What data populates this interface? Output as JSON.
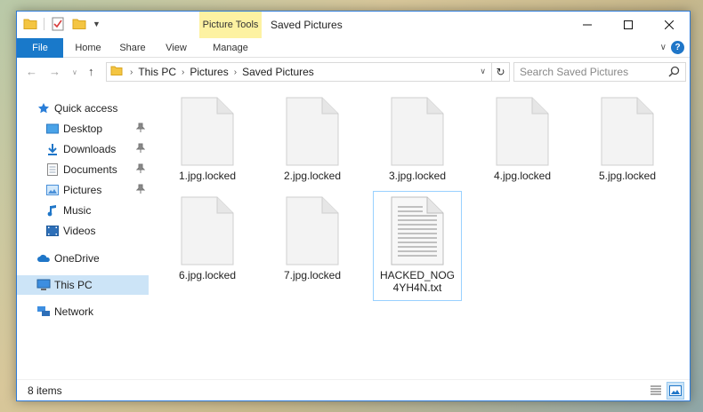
{
  "window": {
    "title": "Saved Pictures",
    "context_tab_group": "Picture Tools"
  },
  "ribbon": {
    "tabs": [
      {
        "label": "File"
      },
      {
        "label": "Home"
      },
      {
        "label": "Share"
      },
      {
        "label": "View"
      },
      {
        "label": "Manage"
      }
    ]
  },
  "address": {
    "breadcrumbs": [
      "This PC",
      "Pictures",
      "Saved Pictures"
    ]
  },
  "search": {
    "placeholder": "Search Saved Pictures"
  },
  "sidebar": {
    "items": [
      {
        "label": "Quick access",
        "icon": "star-icon"
      },
      {
        "label": "Desktop",
        "icon": "desktop-folder-icon",
        "pinned": true
      },
      {
        "label": "Downloads",
        "icon": "downloads-folder-icon",
        "pinned": true
      },
      {
        "label": "Documents",
        "icon": "documents-folder-icon",
        "pinned": true
      },
      {
        "label": "Pictures",
        "icon": "pictures-folder-icon",
        "pinned": true
      },
      {
        "label": "Music",
        "icon": "music-folder-icon"
      },
      {
        "label": "Videos",
        "icon": "videos-folder-icon"
      },
      {
        "label": "OneDrive",
        "icon": "onedrive-icon"
      },
      {
        "label": "This PC",
        "icon": "computer-icon",
        "selected": true
      },
      {
        "label": "Network",
        "icon": "network-icon"
      }
    ]
  },
  "files": [
    {
      "name": "1.jpg.locked",
      "type": "blank"
    },
    {
      "name": "2.jpg.locked",
      "type": "blank"
    },
    {
      "name": "3.jpg.locked",
      "type": "blank"
    },
    {
      "name": "4.jpg.locked",
      "type": "blank"
    },
    {
      "name": "5.jpg.locked",
      "type": "blank"
    },
    {
      "name": "6.jpg.locked",
      "type": "blank"
    },
    {
      "name": "7.jpg.locked",
      "type": "blank"
    },
    {
      "name": "HACKED_NOG4YH4N.txt",
      "type": "text"
    }
  ],
  "status": {
    "item_count": "8 items"
  },
  "colors": {
    "accent": "#1979ca",
    "context_tab": "#fdf2a2",
    "selection": "#cce4f7"
  }
}
